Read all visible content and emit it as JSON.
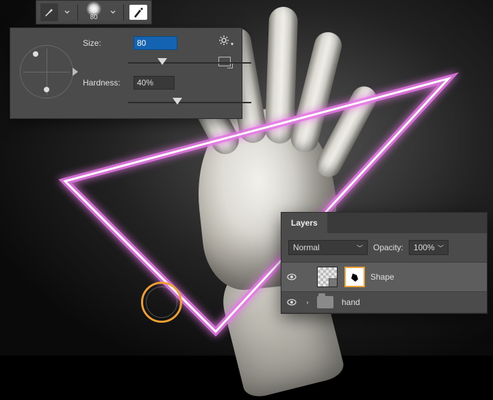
{
  "toolbar": {
    "brush_size_display": "80"
  },
  "brush_panel": {
    "size_label": "Size:",
    "size_value": "80",
    "hardness_label": "Hardness:",
    "hardness_value": "40%",
    "size_slider_pos_pct": 28,
    "hardness_slider_pos_pct": 40
  },
  "layers_panel": {
    "title": "Layers",
    "blend_mode": "Normal",
    "opacity_label": "Opacity:",
    "opacity_value": "100%",
    "layers": [
      {
        "name": "Shape"
      },
      {
        "name": "hand"
      }
    ]
  }
}
